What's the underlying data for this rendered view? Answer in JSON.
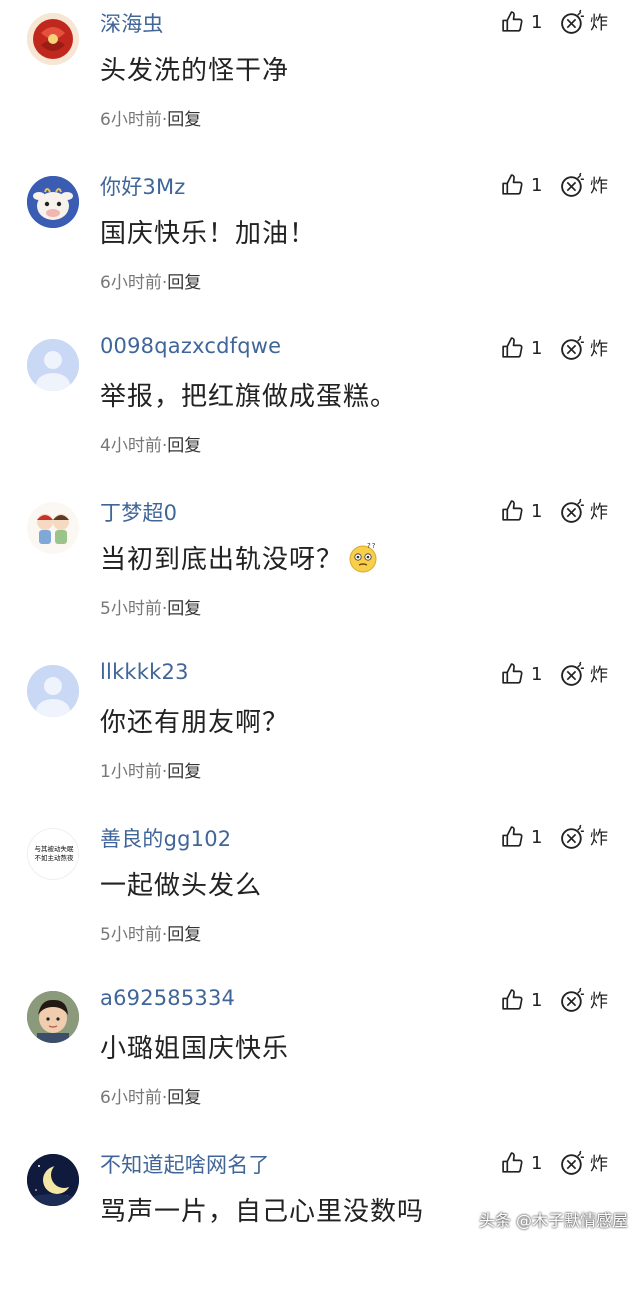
{
  "comments": [
    {
      "username": "深海虫",
      "content": "头发洗的怪干净",
      "time": "6小时前",
      "reply": "回复",
      "likes": "1",
      "bomb": "炸",
      "avatar": "red-knot-avatar"
    },
    {
      "username": "你好3Mz",
      "content": "国庆快乐！加油！",
      "time": "6小时前",
      "reply": "回复",
      "likes": "1",
      "bomb": "炸",
      "avatar": "cartoon-cow-avatar"
    },
    {
      "username": "0098qazxcdfqwe",
      "content": "举报，把红旗做成蛋糕。",
      "time": "4小时前",
      "reply": "回复",
      "likes": "1",
      "bomb": "炸",
      "avatar": "default-avatar"
    },
    {
      "username": "丁梦超0",
      "content": "当初到底出轨没呀？",
      "time": "5小时前",
      "reply": "回复",
      "likes": "1",
      "bomb": "炸",
      "avatar": "cartoon-couple-avatar"
    },
    {
      "username": "llkkkk23",
      "content": "你还有朋友啊？",
      "time": "1小时前",
      "reply": "回复",
      "likes": "1",
      "bomb": "炸",
      "avatar": "default-avatar"
    },
    {
      "username": "善良的gg102",
      "content": "一起做头发么",
      "time": "5小时前",
      "reply": "回复",
      "likes": "1",
      "bomb": "炸",
      "avatar": "text-avatar"
    },
    {
      "username": "a692585334",
      "content": "小璐姐国庆快乐",
      "time": "6小时前",
      "reply": "回复",
      "likes": "1",
      "bomb": "炸",
      "avatar": "child-photo-avatar"
    },
    {
      "username": "不知道起啥网名了",
      "content": "骂声一片，自己心里没数吗",
      "time": "",
      "reply": "",
      "likes": "1",
      "bomb": "炸",
      "avatar": "moon-avatar"
    }
  ],
  "avatar_text": {
    "line1": "与其被动失眠",
    "line2": "不如主动熬夜"
  },
  "watermark": "头条 @木子默情感屋"
}
